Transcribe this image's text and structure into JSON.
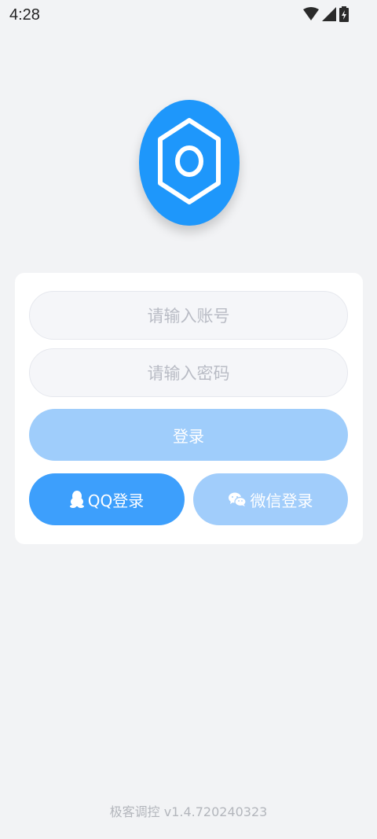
{
  "status_bar": {
    "time": "4:28",
    "icons": [
      "wifi-icon",
      "cellular-signal-icon",
      "battery-charging-icon"
    ]
  },
  "logo": {
    "icon": "hexagon-nut-icon",
    "color": "#1e97fb"
  },
  "login_form": {
    "account_placeholder": "请输入账号",
    "password_placeholder": "请输入密码",
    "login_label": "登录",
    "qq_login_label": "QQ登录",
    "qq_icon": "qq-penguin-icon",
    "wechat_login_label": "微信登录",
    "wechat_icon": "wechat-icon"
  },
  "footer": {
    "version": "极客调控 v1.4.720240323"
  }
}
